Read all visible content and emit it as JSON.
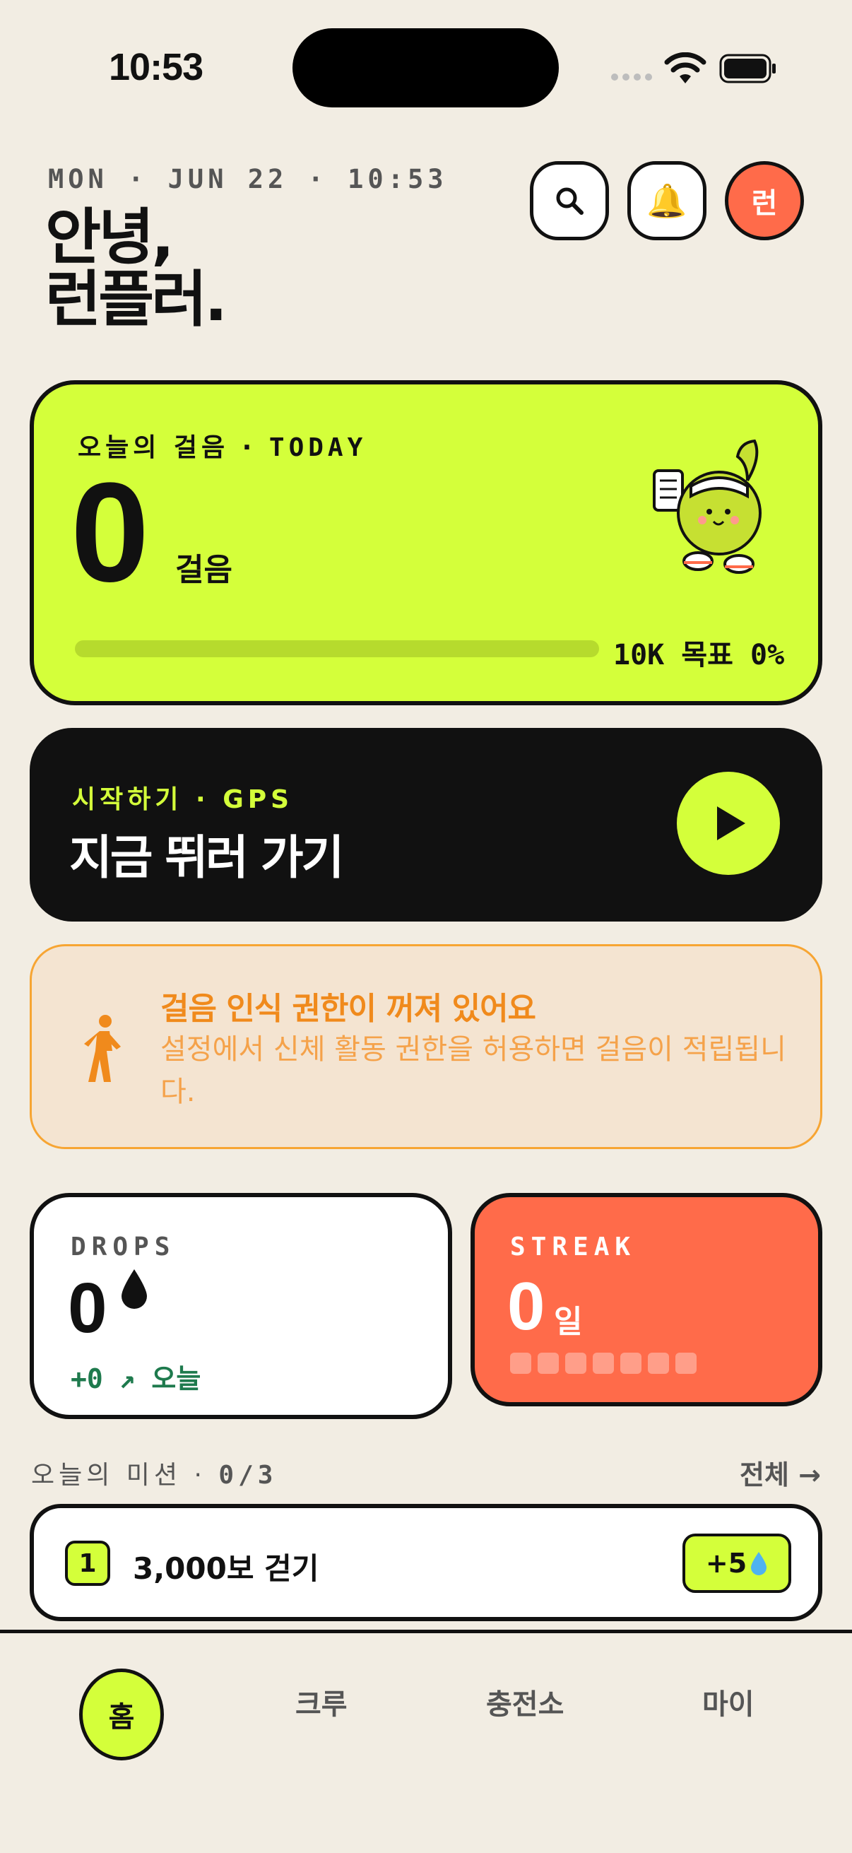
{
  "status_bar": {
    "time": "10:53"
  },
  "header": {
    "date_line": "MON · JUN 22 · 10:53",
    "greeting_line1": "안녕,",
    "greeting_line2": "런플러.",
    "avatar_label": "런"
  },
  "today": {
    "label_kr": "오늘의 걸음",
    "label_sep": " · ",
    "label_en": "TODAY",
    "steps": "0",
    "unit": "걸음",
    "goal_text": "10K 목표 0%",
    "progress_fraction": 0
  },
  "run": {
    "sub": "시작하기 · GPS",
    "title": "지금 뛰러 가기"
  },
  "warning": {
    "title": "걸음 인식 권한이 꺼져 있어요",
    "body": "설정에서 신체 활동 권한을 허용하면 걸음이 적립됩니다."
  },
  "drops": {
    "label": "DROPS",
    "value": "0",
    "delta": "+0 ↗",
    "delta_suffix": "오늘"
  },
  "streak": {
    "label": "STREAK",
    "value": "0",
    "unit": "일",
    "days_filled": 0,
    "days_total": 7
  },
  "missions": {
    "title_kr": "오늘의 미션",
    "title_count": "0/3",
    "title_sep": " · ",
    "all_label": "전체 →",
    "items": [
      {
        "index": "1",
        "text": "3,000보 걷기",
        "reward": "+5"
      }
    ]
  },
  "nav": {
    "items": [
      {
        "label": "홈",
        "active": true
      },
      {
        "label": "크루"
      },
      {
        "label": "충전소"
      },
      {
        "label": "마이"
      }
    ]
  },
  "colors": {
    "background": "#F2EDE3",
    "accent_lime": "#D4FF3A",
    "accent_orange": "#FF6B4A",
    "warning": "#F08A1C",
    "positive": "#1E7A4D"
  },
  "icons": [
    "search-icon",
    "bell-icon",
    "play-icon",
    "walking-icon",
    "drop-icon",
    "wifi-icon",
    "battery-icon",
    "mascot-icon"
  ]
}
